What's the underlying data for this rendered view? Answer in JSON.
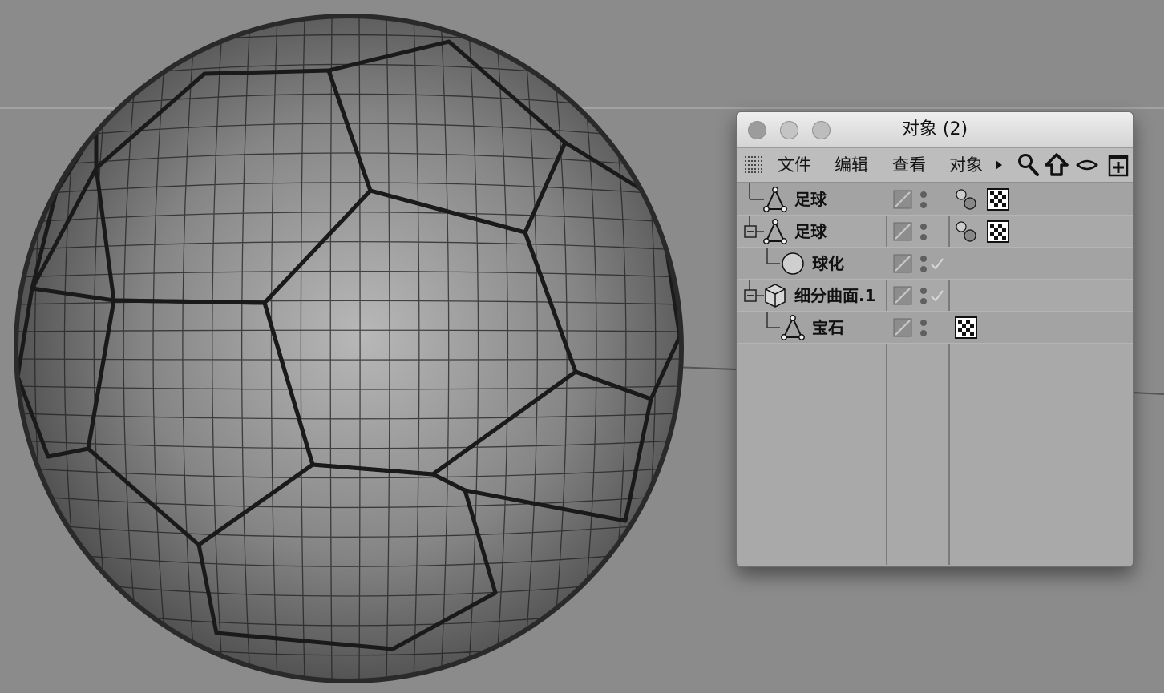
{
  "viewport": {
    "background": "#8b8b8b",
    "ball_dark": "#4a4a4a",
    "ball_light": "#b5b5b5",
    "wire_color": "#1f1f1f",
    "horizon_color": "#a2a2a2"
  },
  "window": {
    "title": "对象 (2)",
    "buttons": [
      "close",
      "minimize",
      "zoom"
    ]
  },
  "menu": {
    "grid_icon": "grid-icon",
    "items": [
      "文件",
      "编辑",
      "查看",
      "对象"
    ],
    "more_icon": "triangle-right-icon",
    "tools": [
      "search-icon",
      "home-icon",
      "eye-icon",
      "add-panel-icon"
    ]
  },
  "objects": [
    {
      "name": "足球",
      "icon": "polygon-object-icon",
      "expand": "none",
      "tags": [
        "phong-tag-icon",
        "material-tag-icon"
      ],
      "checked": false
    },
    {
      "name": "足球",
      "icon": "polygon-object-icon",
      "expand": "collapse",
      "tags": [
        "phong-tag-icon",
        "material-tag-icon"
      ],
      "checked": false
    },
    {
      "name": "球化",
      "icon": "spherify-icon",
      "expand": "none",
      "tags": [],
      "checked": true
    },
    {
      "name": "细分曲面.1",
      "icon": "subdivision-surface-icon",
      "expand": "collapse",
      "tags": [],
      "checked": true
    },
    {
      "name": "宝石",
      "icon": "polygon-object-icon",
      "expand": "none",
      "tags": [
        "material-tag-icon"
      ],
      "checked": false
    }
  ]
}
